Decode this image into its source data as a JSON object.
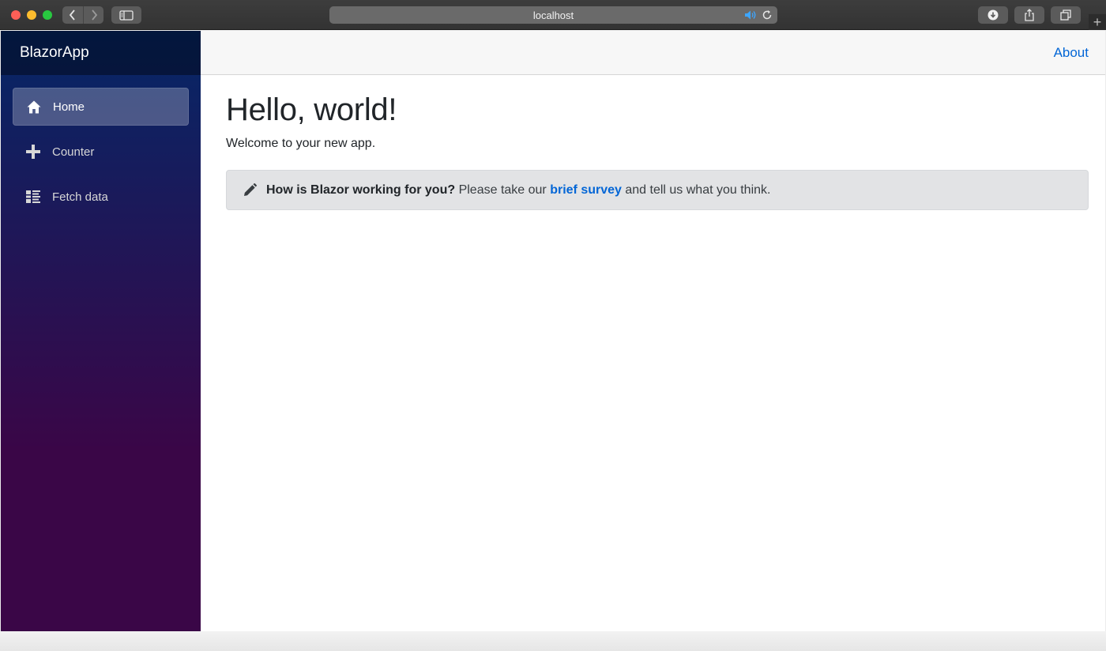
{
  "browser": {
    "url": "localhost",
    "icons": {
      "back": "chevron-left-icon",
      "forward": "chevron-right-icon",
      "sidebar": "sidebar-icon",
      "speaker": "speaker-icon",
      "reload": "reload-icon",
      "download": "download-icon",
      "share": "share-icon",
      "tabs": "tabs-icon",
      "new_tab": "+"
    },
    "colors": {
      "close": "#fc5f57",
      "minimize": "#fdbc2e",
      "maximize": "#28c840"
    }
  },
  "sidebar": {
    "brand": "BlazorApp",
    "items": [
      {
        "label": "Home",
        "icon": "home-icon",
        "active": true
      },
      {
        "label": "Counter",
        "icon": "plus-icon",
        "active": false
      },
      {
        "label": "Fetch data",
        "icon": "list-icon",
        "active": false
      }
    ]
  },
  "top_row": {
    "about": "About"
  },
  "main": {
    "title": "Hello, world!",
    "welcome": "Welcome to your new app.",
    "survey": {
      "question": "How is Blazor working for you?",
      "text_before_link": " Please take our ",
      "link": "brief survey",
      "text_after_link": " and tell us what you think."
    }
  },
  "colors": {
    "accent_link": "#0366d6",
    "sidebar_top": "#052767",
    "sidebar_bottom": "#3a0647"
  }
}
